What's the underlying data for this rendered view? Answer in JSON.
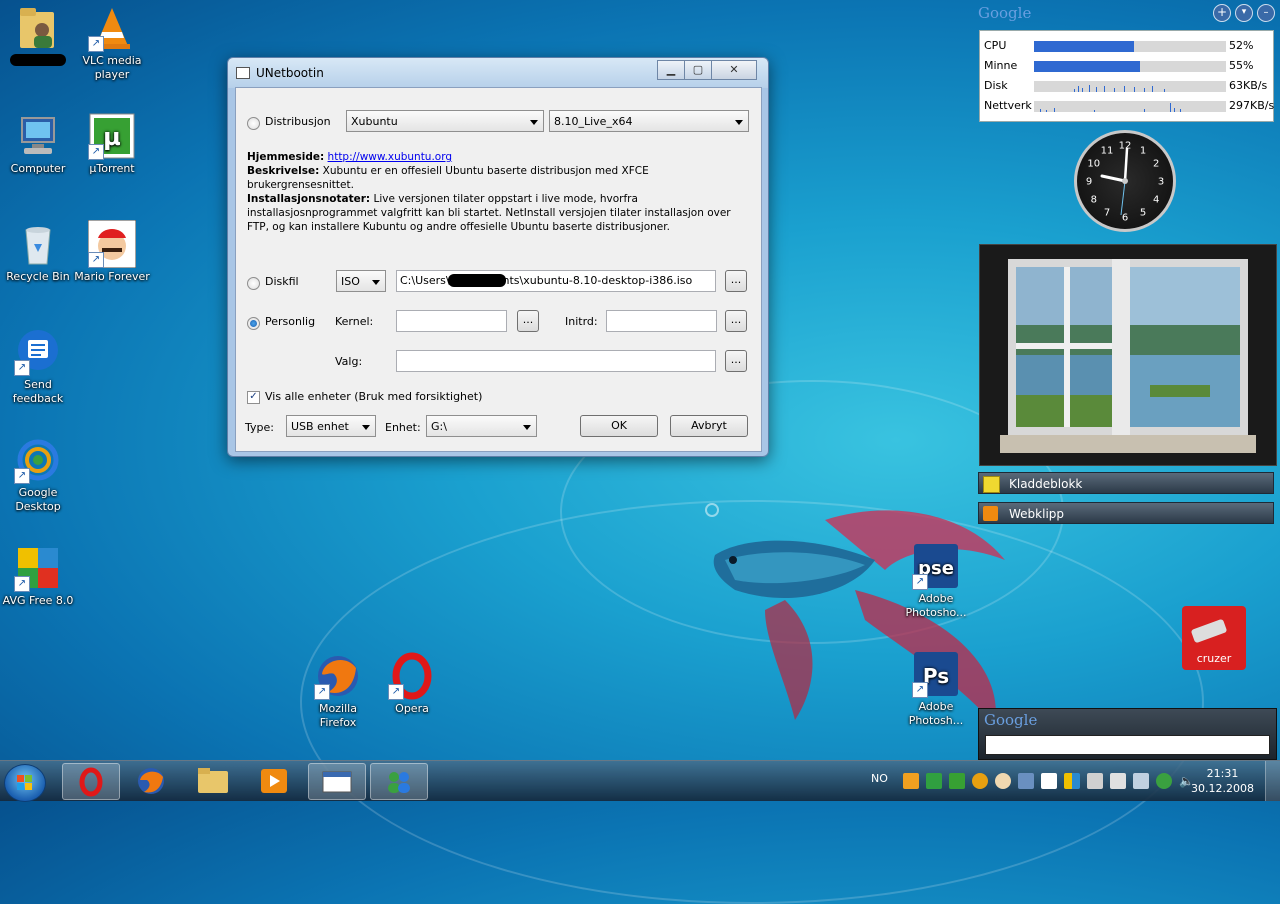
{
  "desktop": {
    "icons": [
      {
        "label": "",
        "kind": "user-folder"
      },
      {
        "label": "VLC media player",
        "kind": "vlc"
      },
      {
        "label": "Computer",
        "kind": "computer"
      },
      {
        "label": "µTorrent",
        "kind": "utorrent"
      },
      {
        "label": "Recycle Bin",
        "kind": "recycle-bin"
      },
      {
        "label": "Mario Forever",
        "kind": "mario"
      },
      {
        "label": "Send feedback",
        "kind": "feedback"
      },
      {
        "label": "Google Desktop",
        "kind": "google-desktop"
      },
      {
        "label": "AVG Free 8.0",
        "kind": "avg"
      },
      {
        "label": "Mozilla Firefox",
        "kind": "firefox"
      },
      {
        "label": "Opera",
        "kind": "opera"
      },
      {
        "label": "Adobe Photosho...",
        "kind": "photoshop-elements"
      },
      {
        "label": "Adobe Photosh...",
        "kind": "photoshop"
      }
    ]
  },
  "window": {
    "title": "UNetbootin",
    "distribusjon_label": "Distribusjon",
    "distro_value": "Xubuntu",
    "version_value": "8.10_Live_x64",
    "homepage_label": "Hjemmeside:",
    "homepage_url": "http://www.xubuntu.org",
    "description_label": "Beskrivelse:",
    "description_text": "Xubuntu er en offesiell Ubuntu baserte distribusjon med XFCE brukergrensesnittet.",
    "notes_label": "Installasjonsnotater:",
    "notes_text": "Live versjonen tilater oppstart i live mode, hvorfra installasjosnprogrammet valgfritt kan bli startet. NetInstall versjojen tilater installasjon over FTP, og kan installere Kubuntu og andre offesielle Ubuntu baserte distribusjoner.",
    "diskfil_label": "Diskfil",
    "diskfil_type": "ISO",
    "diskfil_path": "C:\\Users\\      \\Documents\\xubuntu-8.10-desktop-i386.iso",
    "browse_label": "...",
    "personlig_label": "Personlig",
    "kernel_label": "Kernel:",
    "initrd_label": "Initrd:",
    "valg_label": "Valg:",
    "show_all_label": "Vis alle enheter (Bruk med forsiktighet)",
    "type_label": "Type:",
    "type_value": "USB enhet",
    "enhet_label": "Enhet:",
    "enhet_value": "G:\\",
    "ok_label": "OK",
    "cancel_label": "Avbryt"
  },
  "sidebar": {
    "google_label": "Google",
    "meter": [
      {
        "name": "CPU",
        "value": "52%",
        "fraction": 0.52
      },
      {
        "name": "Minne",
        "value": "55%",
        "fraction": 0.55
      },
      {
        "name": "Disk",
        "value": "63KB/s"
      },
      {
        "name": "Nettverk",
        "value": "297KB/s"
      }
    ],
    "clock_numbers": [
      "12",
      "1",
      "2",
      "3",
      "4",
      "5",
      "6",
      "7",
      "8",
      "9",
      "10",
      "11"
    ],
    "gadget_notes": "Kladdeblokk",
    "gadget_web": "Webklipp",
    "google_search_label": "Google",
    "usb_label": "cruzer"
  },
  "taskbar": {
    "lang": "NO",
    "time": "21:31",
    "date": "30.12.2008"
  }
}
